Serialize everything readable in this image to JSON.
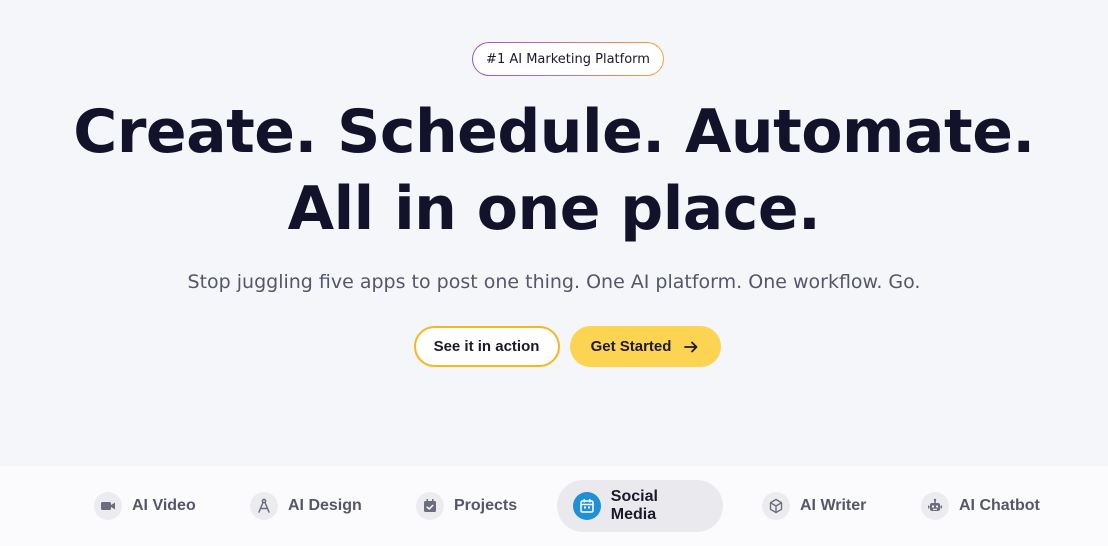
{
  "badge": {
    "label": "#1 AI Marketing Platform"
  },
  "hero": {
    "headline_line1": "Create. Schedule. Automate.",
    "headline_line2": "All in one place.",
    "subtitle": "Stop juggling five apps to post one thing. One AI platform. One workflow. Go."
  },
  "cta": {
    "secondary_label": "See it in action",
    "primary_label": "Get Started"
  },
  "colors": {
    "accent_yellow": "#fdd452",
    "outline_yellow": "#f5b820",
    "active_tab_icon": "#1f8fd6"
  },
  "tabs": [
    {
      "label": "AI Video",
      "icon": "video-camera-icon",
      "active": false
    },
    {
      "label": "AI Design",
      "icon": "compass-icon",
      "active": false
    },
    {
      "label": "Projects",
      "icon": "calendar-check-icon",
      "active": false
    },
    {
      "label": "Social Media",
      "icon": "calendar-icon",
      "active": true
    },
    {
      "label": "AI Writer",
      "icon": "cube-icon",
      "active": false
    },
    {
      "label": "AI Chatbot",
      "icon": "robot-icon",
      "active": false
    }
  ]
}
